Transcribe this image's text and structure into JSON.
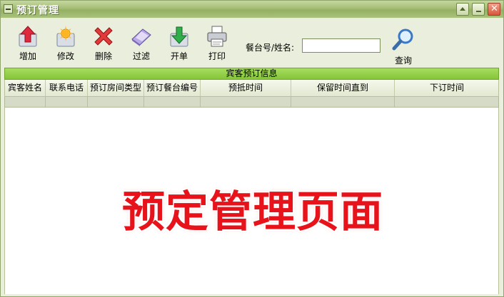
{
  "window": {
    "title": "预订管理"
  },
  "toolbar": {
    "buttons": [
      {
        "label": "增加",
        "icon": "add-arrow-up-icon"
      },
      {
        "label": "修改",
        "icon": "edit-sparkle-icon"
      },
      {
        "label": "删除",
        "icon": "delete-x-icon"
      },
      {
        "label": "过滤",
        "icon": "filter-funnel-icon"
      },
      {
        "label": "开单",
        "icon": "open-bill-icon"
      },
      {
        "label": "打印",
        "icon": "printer-icon"
      }
    ],
    "search_label": "餐台号/姓名:",
    "search_value": "",
    "query_label": "查询"
  },
  "grid": {
    "group_title": "宾客预订信息",
    "columns": [
      "宾客姓名",
      "联系电话",
      "预订房间类型",
      "预订餐台编号",
      "预抵时间",
      "保留时间直到",
      "下订时间"
    ],
    "rows": []
  },
  "overlay_text": "预定管理页面",
  "colors": {
    "titlebar": "#9fba6f",
    "header_green": "#96d14a",
    "overlay_red": "#e8121a"
  }
}
